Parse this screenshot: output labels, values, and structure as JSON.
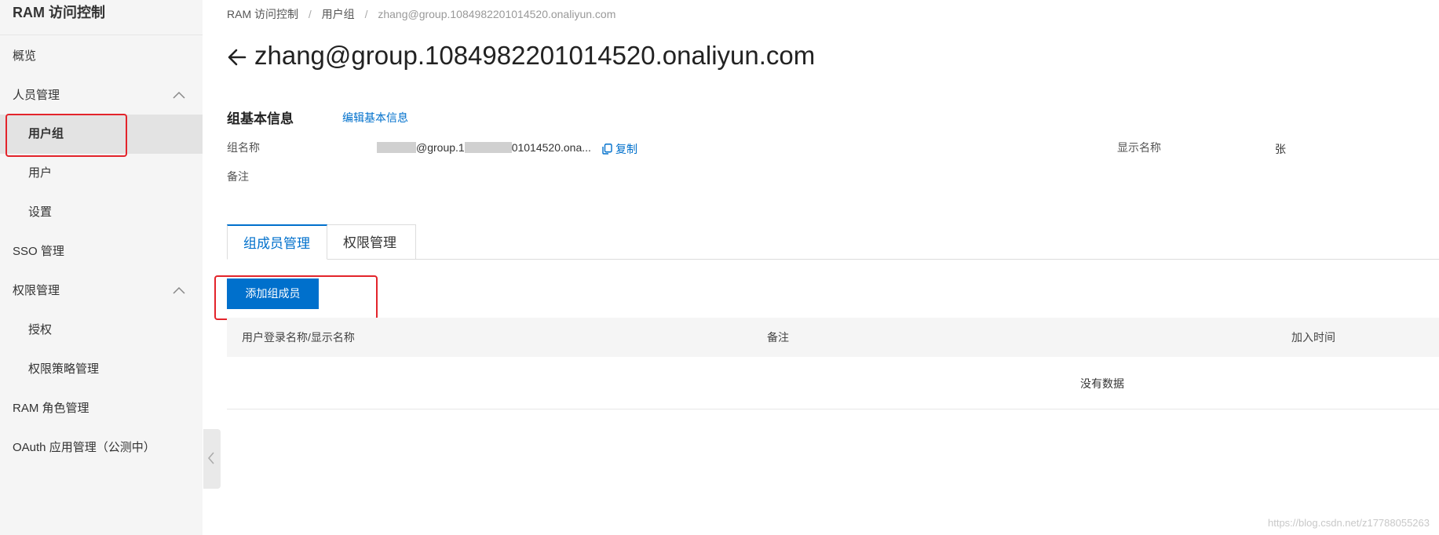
{
  "sidebar": {
    "title": "RAM 访问控制",
    "items": [
      {
        "label": "概览"
      },
      {
        "label": "人员管理"
      },
      {
        "label": "用户组"
      },
      {
        "label": "用户"
      },
      {
        "label": "设置"
      },
      {
        "label": "SSO 管理"
      },
      {
        "label": "权限管理"
      },
      {
        "label": "授权"
      },
      {
        "label": "权限策略管理"
      },
      {
        "label": "RAM 角色管理"
      },
      {
        "label": "OAuth 应用管理（公测中）"
      }
    ]
  },
  "breadcrumb": {
    "items": [
      "RAM 访问控制",
      "用户组",
      "zhang@group.1084982201014520.onaliyun.com"
    ],
    "separator": "/"
  },
  "page": {
    "title": "zhang@group.1084982201014520.onaliyun.com"
  },
  "basic_info": {
    "section_title": "组基本信息",
    "edit_label": "编辑基本信息",
    "group_name_label": "组名称",
    "group_name_value_mid": "@group.1",
    "group_name_value_end": "01014520.ona...",
    "copy_label": "复制",
    "display_name_label": "显示名称",
    "display_name_value": "张",
    "remark_label": "备注"
  },
  "tabs": [
    {
      "label": "组成员管理",
      "active": true
    },
    {
      "label": "权限管理",
      "active": false
    }
  ],
  "actions": {
    "add_member_label": "添加组成员"
  },
  "table": {
    "columns": [
      "用户登录名称/显示名称",
      "备注",
      "加入时间"
    ],
    "empty_text": "没有数据"
  },
  "watermark": "https://blog.csdn.net/z17788055263",
  "colors": {
    "accent": "#0070cc",
    "annotation": "#e3242b",
    "sidebar_bg": "#f5f5f5"
  }
}
